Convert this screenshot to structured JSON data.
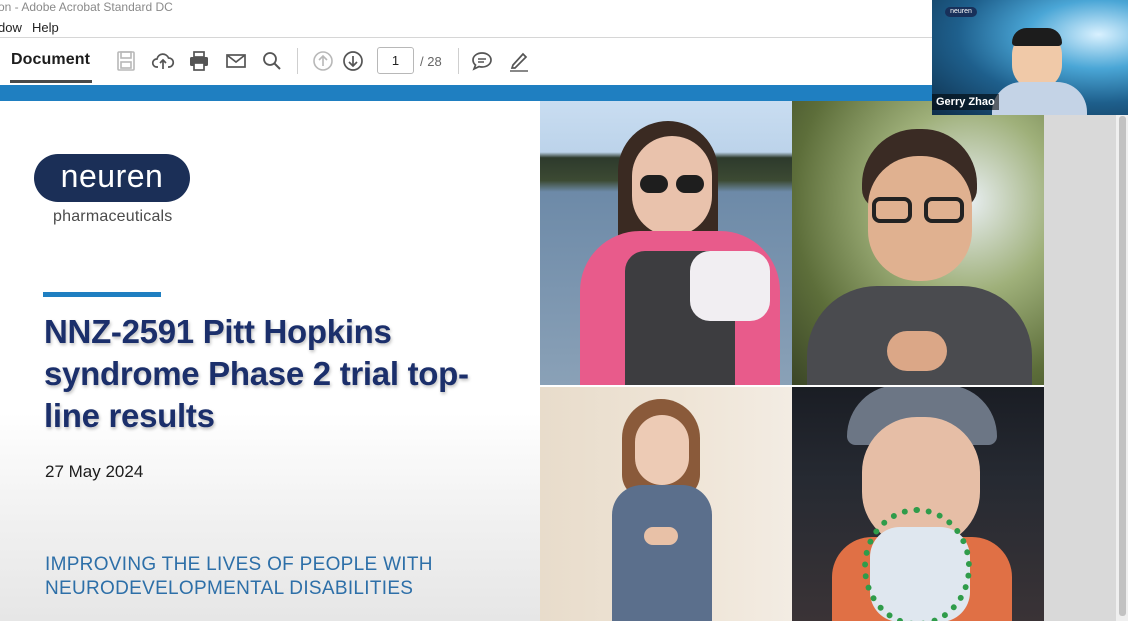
{
  "window": {
    "title": "on - Adobe Acrobat Standard DC"
  },
  "menu": {
    "items": [
      "dow",
      "Help"
    ]
  },
  "toolbar": {
    "document_tab": "Document",
    "icons": [
      "save-icon",
      "upload-cloud-icon",
      "print-icon",
      "email-icon",
      "search-icon",
      "prev-page-icon",
      "next-page-icon",
      "comment-icon",
      "highlight-pen-icon"
    ],
    "page_current": "1",
    "page_total": "/ 28"
  },
  "slide": {
    "logo_text": "neuren",
    "logo_sub": "pharmaceuticals",
    "title": "NNZ-2591 Pitt Hopkins syndrome Phase 2 trial top-line results",
    "date": "27 May 2024",
    "tagline": "IMPROVING THE LIVES OF PEOPLE WITH NEURODEVELOPMENTAL DISABILITIES"
  },
  "video": {
    "logo": "neuren",
    "participant_name": "Gerry Zhao"
  },
  "colors": {
    "accent_blue": "#1f7fc1",
    "navy": "#1b2f6b",
    "tagline_blue": "#2d6fa8"
  }
}
